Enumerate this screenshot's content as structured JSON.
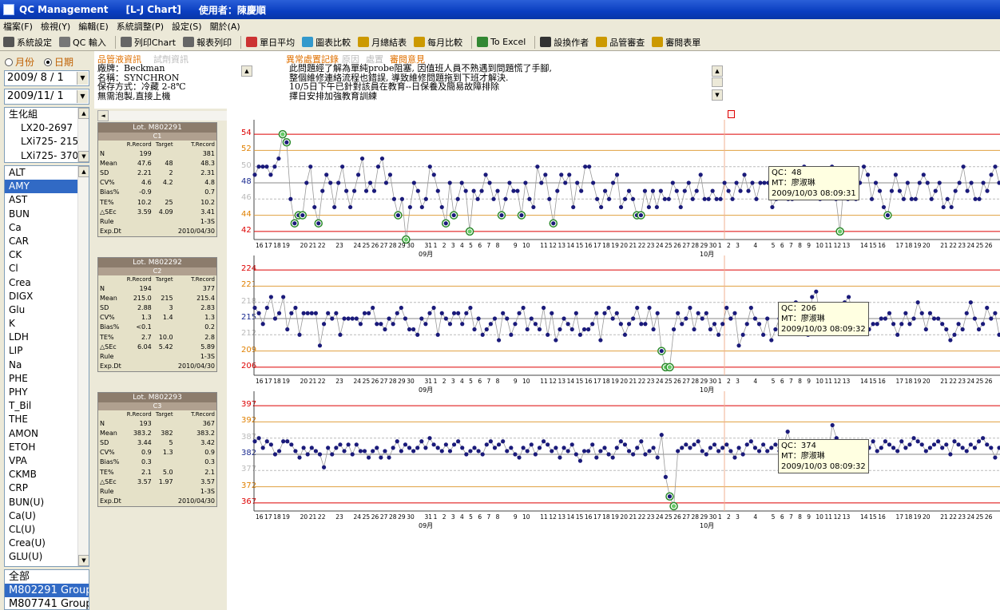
{
  "window": {
    "title": "QC Management",
    "subtitle": "[L-J Chart]",
    "user": "使用者：陳慶順"
  },
  "menu": [
    "檔案(F)",
    "檢視(Y)",
    "編輯(E)",
    "系統調整(P)",
    "設定(S)",
    "關於(A)"
  ],
  "toolbar": [
    {
      "label": "系統設定",
      "icon": "settings-icon",
      "color": "#555"
    },
    {
      "label": "QC 輸入",
      "icon": "keyboard-icon",
      "color": "#777"
    },
    {
      "label": "列印Chart",
      "icon": "printer-icon",
      "color": "#666"
    },
    {
      "label": "報表列印",
      "icon": "report-print-icon",
      "color": "#666"
    },
    {
      "label": "單日平均",
      "icon": "pen-icon",
      "color": "#c33"
    },
    {
      "label": "圖表比較",
      "icon": "chart-compare-icon",
      "color": "#39c"
    },
    {
      "label": "月總結表",
      "icon": "hand-icon",
      "color": "#c90"
    },
    {
      "label": "每月比較",
      "icon": "hand-icon",
      "color": "#c90"
    },
    {
      "label": "To Excel",
      "icon": "excel-icon",
      "color": "#383"
    },
    {
      "label": "設換作者",
      "icon": "eye-icon",
      "color": "#333"
    },
    {
      "label": "品管審查",
      "icon": "review-icon",
      "color": "#c90"
    },
    {
      "label": "審閱表單",
      "icon": "hand-icon",
      "color": "#c90"
    }
  ],
  "left": {
    "radio_month": "月份",
    "radio_date": "日期",
    "date_from": "2009/ 8 / 1",
    "date_to": "2009/11/ 1",
    "instruments": [
      "生化組",
      "LX20-2697",
      "LXi725- 215",
      "LXi725- 370"
    ],
    "tests": [
      "ALT",
      "AMY",
      "AST",
      "BUN",
      "Ca",
      "CAR",
      "CK",
      "Cl",
      "Crea",
      "DIGX",
      "Glu",
      "K",
      "LDH",
      "LIP",
      "Na",
      "PHE",
      "PHY",
      "T_Bil",
      "THE",
      "AMON",
      "ETOH",
      "VPA",
      "CKMB",
      "CRP",
      "BUN(U)",
      "Ca(U)",
      "CL(U)",
      "Crea(U)",
      "GLU(U)"
    ],
    "selected_test": "AMY",
    "groups": [
      "全部",
      "M802291 Group",
      "M807741 Group"
    ],
    "selected_group": "M802291 Group"
  },
  "info": {
    "tab1": "品管液資訊",
    "tab2": "試劑資訊",
    "reagent_lines": [
      "廠牌：Beckman",
      "名稱：SYNCHRON",
      "保存方式：冷藏 2-8℃",
      "無需泡製,直接上機"
    ],
    "tab3": "異常處置記錄",
    "tab4": "原因",
    "tab5": "處置",
    "tab6": "審閱意見",
    "remark_lines": [
      "此問題經了解為單純probe阻塞, 因值班人員不熟遇到問題慌了手腳,",
      "整個維修連絡流程也錯誤, 導致維修問題拖到下班才解決.",
      "10/5日下午已針對該員在教育--日保養及簡易故障排除",
      "擇日安排加強教育訓練"
    ]
  },
  "stats": [
    {
      "lot": "Lot. M802291",
      "level": "C1",
      "rows": [
        [
          "N",
          "199",
          "",
          "381"
        ],
        [
          "Mean",
          "47.6",
          "48",
          "48.3"
        ],
        [
          "SD",
          "2.21",
          "2",
          "2.31"
        ],
        [
          "CV%",
          "4.6",
          "4.2",
          "4.8"
        ],
        [
          "Bias%",
          "-0.9",
          "",
          "0.7"
        ],
        [
          "TE%",
          "10.2",
          "25",
          "10.2"
        ],
        [
          "△SEc",
          "3.59",
          "4.09",
          "3.41"
        ],
        [
          "Rule",
          "",
          "",
          "1-3S"
        ],
        [
          "Exp.Dt",
          "",
          "",
          "2010/04/30"
        ]
      ]
    },
    {
      "lot": "Lot. M802292",
      "level": "C2",
      "rows": [
        [
          "N",
          "194",
          "",
          "377"
        ],
        [
          "Mean",
          "215.0",
          "215",
          "215.4"
        ],
        [
          "SD",
          "2.88",
          "3",
          "2.83"
        ],
        [
          "CV%",
          "1.3",
          "1.4",
          "1.3"
        ],
        [
          "Bias%",
          "<0.1",
          "",
          "0.2"
        ],
        [
          "TE%",
          "2.7",
          "10.0",
          "2.8"
        ],
        [
          "△SEc",
          "6.04",
          "5.42",
          "5.89"
        ],
        [
          "Rule",
          "",
          "",
          "1-3S"
        ],
        [
          "Exp.Dt",
          "",
          "",
          "2010/04/30"
        ]
      ]
    },
    {
      "lot": "Lot. M802293",
      "level": "C3",
      "rows": [
        [
          "N",
          "193",
          "",
          "367"
        ],
        [
          "Mean",
          "383.2",
          "382",
          "383.2"
        ],
        [
          "SD",
          "3.44",
          "5",
          "3.42"
        ],
        [
          "CV%",
          "0.9",
          "1.3",
          "0.9"
        ],
        [
          "Bias%",
          "0.3",
          "",
          "0.3"
        ],
        [
          "TE%",
          "2.1",
          "5.0",
          "2.1"
        ],
        [
          "△SEc",
          "3.57",
          "1.97",
          "3.57"
        ],
        [
          "Rule",
          "",
          "",
          "1-3S"
        ],
        [
          "Exp.Dt",
          "",
          "",
          "2010/04/30"
        ]
      ]
    }
  ],
  "stats_header": {
    "rr": "R.Record",
    "tg": "Target",
    "tr": "T.Record"
  },
  "chart_data": [
    {
      "type": "line",
      "levels": [
        54,
        52,
        50,
        48,
        46,
        44,
        42
      ],
      "mean": 48,
      "sd": 2,
      "tooltip": {
        "qc": "QC：48",
        "mt": "MT：廖淑琳",
        "time": "2009/10/03 08:09:31"
      },
      "values": [
        49,
        50,
        50,
        50,
        49,
        50,
        51,
        54,
        53,
        46,
        43,
        44,
        44,
        48,
        50,
        45,
        43,
        47,
        49,
        48,
        45,
        48,
        50,
        47,
        45,
        47,
        49,
        51,
        47,
        48,
        47,
        50,
        51,
        48,
        49,
        46,
        44,
        46,
        41,
        45,
        48,
        47,
        45,
        46,
        50,
        49,
        47,
        45,
        43,
        48,
        44,
        46,
        48,
        47,
        42,
        47,
        46,
        47,
        49,
        48,
        46,
        47,
        44,
        46,
        48,
        47,
        47,
        44,
        48,
        46,
        45,
        50,
        48,
        49,
        46,
        43,
        47,
        49,
        48,
        49,
        45,
        48,
        47,
        50,
        50,
        48,
        46,
        45,
        47,
        46,
        48,
        49,
        45,
        46,
        47,
        46,
        44,
        44,
        47,
        45,
        47,
        45,
        47,
        46,
        46,
        48,
        47,
        45,
        47,
        48,
        46,
        47,
        49,
        46,
        46,
        47,
        46,
        46,
        48,
        47,
        46,
        48,
        47,
        49,
        47,
        48,
        46,
        48,
        48,
        48,
        45,
        46,
        47,
        49,
        46,
        46,
        47,
        48,
        50,
        48,
        47,
        49,
        46,
        47,
        48,
        50,
        46,
        42,
        48,
        46,
        47,
        46,
        48,
        50,
        49,
        46,
        48,
        47,
        45,
        44,
        47,
        49,
        47,
        46,
        48,
        46,
        46,
        48,
        49,
        48,
        46,
        47,
        48,
        45,
        46,
        45,
        47,
        48,
        50,
        47,
        48,
        46,
        46,
        48,
        47,
        49,
        50,
        48
      ]
    },
    {
      "type": "line",
      "levels": [
        224,
        221,
        218,
        215,
        212,
        209,
        206
      ],
      "mean": 215,
      "sd": 3,
      "tooltip": {
        "qc": "QC：206",
        "mt": "MT：廖淑琳",
        "time": "2009/10/03 08:09:32"
      },
      "values": [
        217,
        216,
        214,
        217,
        219,
        215,
        216,
        219,
        213,
        216,
        217,
        212,
        216,
        216,
        216,
        216,
        210,
        214,
        216,
        215,
        216,
        212,
        215,
        215,
        215,
        215,
        214,
        216,
        216,
        217,
        214,
        214,
        213,
        215,
        214,
        216,
        217,
        215,
        213,
        213,
        212,
        215,
        214,
        216,
        217,
        212,
        216,
        215,
        214,
        216,
        216,
        214,
        216,
        217,
        213,
        215,
        212,
        213,
        214,
        215,
        211,
        216,
        215,
        212,
        214,
        216,
        217,
        213,
        215,
        214,
        213,
        217,
        212,
        216,
        211,
        213,
        215,
        214,
        213,
        216,
        212,
        213,
        213,
        214,
        216,
        211,
        216,
        217,
        215,
        216,
        214,
        212,
        214,
        215,
        217,
        214,
        214,
        217,
        213,
        216,
        209,
        206,
        206,
        213,
        216,
        214,
        215,
        217,
        213,
        216,
        215,
        216,
        213,
        214,
        212,
        214,
        217,
        215,
        216,
        210,
        212,
        214,
        217,
        215,
        214,
        212,
        215,
        211,
        213,
        215,
        213,
        214,
        216,
        218,
        215,
        214,
        212,
        219,
        220,
        215,
        217,
        216,
        214,
        215,
        217,
        218,
        219,
        216,
        217,
        213,
        215,
        213,
        214,
        214,
        215,
        215,
        216,
        214,
        212,
        214,
        216,
        214,
        215,
        218,
        216,
        213,
        216,
        215,
        215,
        214,
        213,
        211,
        212,
        214,
        213,
        216,
        218,
        215,
        213,
        214,
        217,
        215,
        216,
        212
      ]
    },
    {
      "type": "line",
      "levels": [
        397,
        392,
        387,
        382,
        377,
        372,
        367
      ],
      "mean": 382,
      "sd": 5,
      "tooltip": {
        "qc": "QC：374",
        "mt": "MT：廖淑琳",
        "time": "2009/10/03 08:09:32"
      },
      "values": [
        386,
        387,
        384,
        386,
        385,
        382,
        383,
        386,
        386,
        385,
        383,
        381,
        384,
        382,
        384,
        383,
        382,
        378,
        384,
        382,
        384,
        385,
        383,
        385,
        382,
        385,
        383,
        383,
        381,
        383,
        384,
        381,
        383,
        381,
        384,
        386,
        383,
        385,
        384,
        383,
        384,
        386,
        384,
        387,
        385,
        384,
        383,
        385,
        383,
        385,
        386,
        384,
        382,
        383,
        384,
        383,
        382,
        385,
        386,
        384,
        385,
        386,
        383,
        384,
        382,
        381,
        384,
        383,
        385,
        382,
        384,
        386,
        385,
        383,
        384,
        381,
        384,
        383,
        385,
        382,
        380,
        383,
        383,
        385,
        381,
        383,
        384,
        382,
        381,
        384,
        386,
        385,
        383,
        382,
        384,
        386,
        382,
        383,
        384,
        381,
        388,
        375,
        369,
        366,
        383,
        384,
        385,
        384,
        385,
        386,
        383,
        382,
        384,
        385,
        383,
        384,
        385,
        383,
        381,
        384,
        382,
        385,
        386,
        384,
        383,
        385,
        383,
        384,
        385,
        383,
        385,
        389,
        384,
        386,
        383,
        385,
        384,
        383,
        385,
        382,
        384,
        383,
        391,
        387,
        384,
        385,
        384,
        386,
        384,
        383,
        385,
        384,
        386,
        383,
        384,
        386,
        385,
        384,
        383,
        386,
        384,
        385,
        387,
        386,
        385,
        383,
        384,
        385,
        386,
        384,
        385,
        382,
        386,
        385,
        384,
        383,
        385,
        384,
        386,
        387,
        385,
        384,
        381,
        384
      ]
    }
  ],
  "xaxis": {
    "sep_days": [
      "16",
      "17",
      "18",
      "19",
      "",
      "20",
      "21",
      "22",
      "",
      "23",
      "",
      "24",
      "25",
      "26",
      "27",
      "28",
      "29",
      "30",
      "",
      "31",
      "1",
      "2",
      "3",
      "4",
      "5",
      "6",
      "7",
      "8",
      "",
      "9",
      "10",
      "",
      "11",
      "12",
      "13",
      "14",
      "15",
      "16",
      "17",
      "18",
      "19",
      "20",
      "21",
      "22",
      "23",
      "24",
      "25",
      "26",
      "27",
      "28",
      "29",
      "30",
      "1",
      "2",
      "3",
      "",
      "4",
      "",
      "5",
      "6",
      "7",
      "8",
      "9",
      "10",
      "11",
      "12",
      "13",
      "",
      "14",
      "15",
      "16",
      "",
      "17",
      "18",
      "19",
      "20",
      "",
      "21",
      "22",
      "23",
      "24",
      "25",
      "26"
    ],
    "month_sep": "09月",
    "month_oct": "10月"
  }
}
